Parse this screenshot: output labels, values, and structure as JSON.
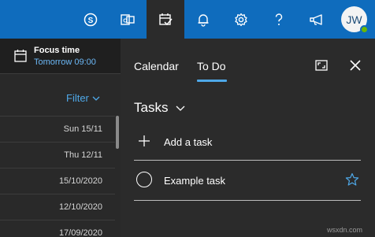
{
  "topbar": {
    "buttons": [
      {
        "name": "skype",
        "icon": "skype-icon"
      },
      {
        "name": "office",
        "icon": "office-icon"
      },
      {
        "name": "my-day",
        "icon": "calendar-check-icon",
        "active": true
      },
      {
        "name": "notifications",
        "icon": "bell-icon"
      },
      {
        "name": "settings",
        "icon": "gear-icon"
      },
      {
        "name": "help",
        "icon": "question-icon"
      },
      {
        "name": "feedback",
        "icon": "megaphone-icon"
      }
    ],
    "avatar_initials": "JW",
    "presence_color": "#6bb700",
    "bar_color": "#0f6cbd"
  },
  "left_panel": {
    "focus": {
      "title": "Focus time",
      "time": "Tomorrow 09:00"
    },
    "filter_label": "Filter",
    "dates": [
      "Sun 15/11",
      "Thu 12/11",
      "15/10/2020",
      "12/10/2020",
      "17/09/2020"
    ]
  },
  "right_panel": {
    "tabs": [
      {
        "label": "Calendar",
        "active": false
      },
      {
        "label": "To Do",
        "active": true
      }
    ],
    "list_title": "Tasks",
    "add_task_label": "Add a task",
    "tasks": [
      {
        "title": "Example task",
        "completed": false,
        "starred": false
      }
    ],
    "accent_color": "#4ea8e8"
  },
  "watermark": "wsxdn.com"
}
